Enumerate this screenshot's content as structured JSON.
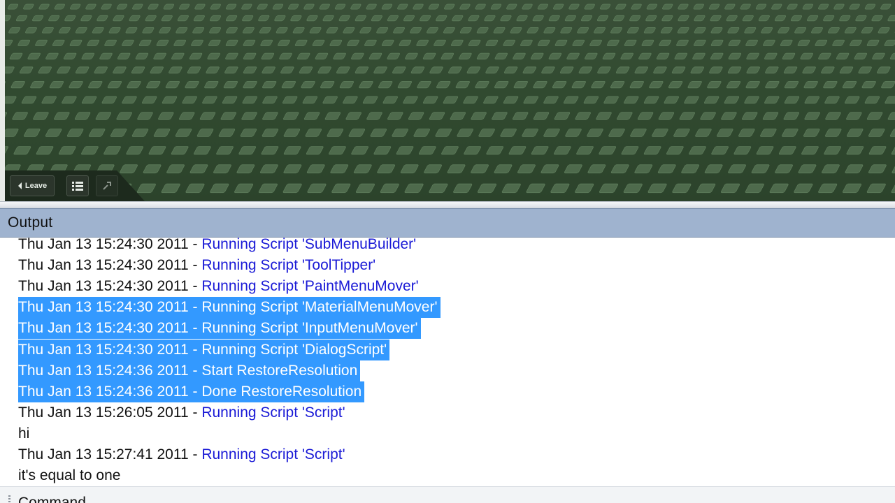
{
  "scene": {
    "leave_label": "Leave",
    "icons": [
      "back-arrow-icon",
      "list-menu-icon",
      "tool-icon"
    ]
  },
  "output": {
    "title": "Output",
    "lines": [
      {
        "ts": "Thu Jan 13 15:24:30 2011",
        "sep": " - ",
        "msg": "Running Script 'SubMenuBuilder'",
        "kind": "blue",
        "selected": false
      },
      {
        "ts": "Thu Jan 13 15:24:30 2011",
        "sep": " - ",
        "msg": "Running Script 'ToolTipper'",
        "kind": "blue",
        "selected": false
      },
      {
        "ts": "Thu Jan 13 15:24:30 2011",
        "sep": " - ",
        "msg": "Running Script 'PaintMenuMover'",
        "kind": "blue",
        "selected": false
      },
      {
        "ts": "Thu Jan 13 15:24:30 2011",
        "sep": " - ",
        "msg": "Running Script 'MaterialMenuMover'",
        "kind": "blue",
        "selected": true
      },
      {
        "ts": "Thu Jan 13 15:24:30 2011",
        "sep": " - ",
        "msg": "Running Script 'InputMenuMover'",
        "kind": "blue",
        "selected": true
      },
      {
        "ts": "Thu Jan 13 15:24:30 2011",
        "sep": " - ",
        "msg": "Running Script 'DialogScript'",
        "kind": "blue",
        "selected": true
      },
      {
        "ts": "Thu Jan 13 15:24:36 2011",
        "sep": " - ",
        "msg": "Start RestoreResolution",
        "kind": "plain",
        "selected": true
      },
      {
        "ts": "Thu Jan 13 15:24:36 2011",
        "sep": " - ",
        "msg": "Done RestoreResolution",
        "kind": "plain",
        "selected": true
      },
      {
        "ts": "Thu Jan 13 15:26:05 2011",
        "sep": " - ",
        "msg": "Running Script 'Script'",
        "kind": "blue",
        "selected": false
      },
      {
        "ts": "",
        "sep": "",
        "msg": "hi",
        "kind": "plain",
        "selected": false
      },
      {
        "ts": "Thu Jan 13 15:27:41 2011",
        "sep": " - ",
        "msg": "Running Script 'Script'",
        "kind": "blue",
        "selected": false
      },
      {
        "ts": "",
        "sep": "",
        "msg": "it's equal to one",
        "kind": "plain",
        "selected": false
      }
    ]
  },
  "command": {
    "title": "Command"
  },
  "colors": {
    "selection": "#3399ff",
    "script_blue": "#1a1ad6",
    "header": "#9fb3cf",
    "baseplate": "#314a30"
  }
}
